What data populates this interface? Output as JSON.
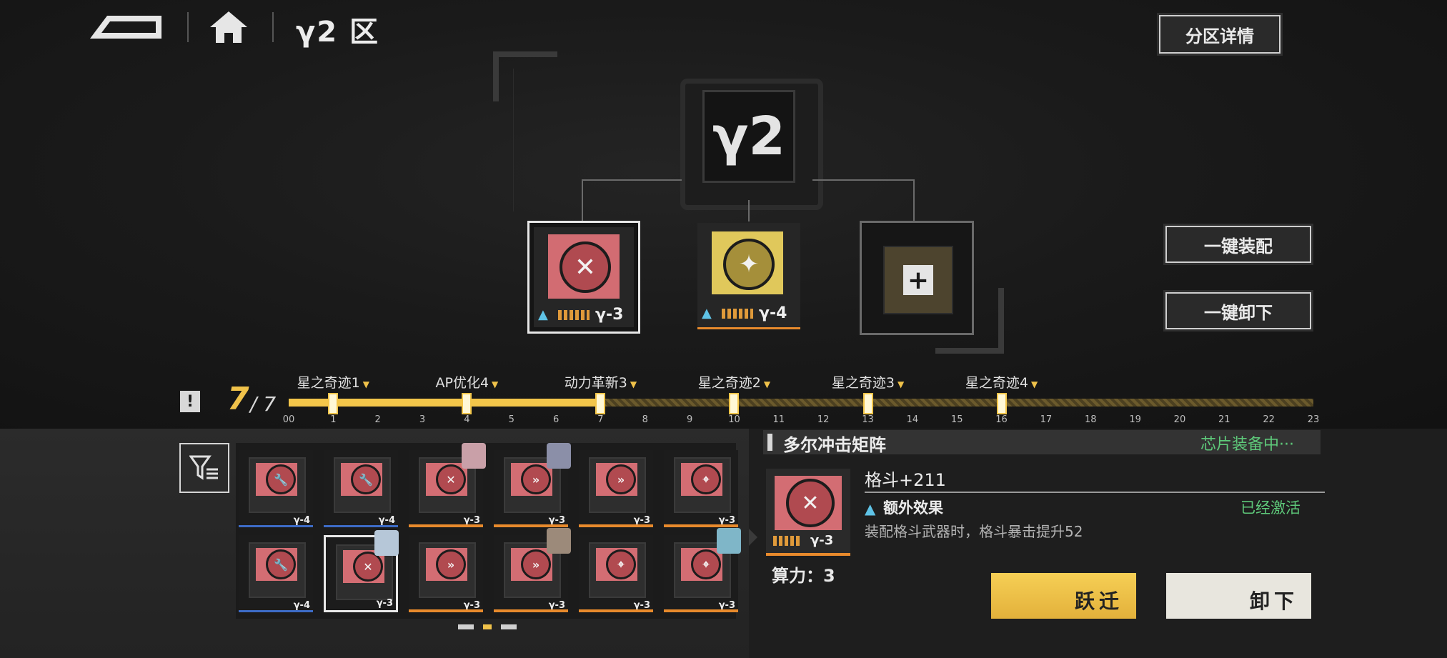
{
  "header": {
    "zone_title": "γ2 区",
    "zone_detail_label": "分区详情"
  },
  "core": {
    "glyph": "γ2"
  },
  "slots": [
    {
      "tier": "γ-3",
      "emblem": "✕"
    },
    {
      "tier": "γ-4",
      "emblem": "✦"
    },
    {
      "add_label": "+"
    }
  ],
  "actions": {
    "equip_all": "一键装配",
    "unequip_all": "一键卸下"
  },
  "progress": {
    "current": "7",
    "max": "/ 7",
    "alert": "!",
    "fraction": 0.304,
    "ticks": [
      "00",
      "1",
      "2",
      "3",
      "4",
      "5",
      "6",
      "7",
      "8",
      "9",
      "10",
      "11",
      "12",
      "13",
      "14",
      "15",
      "16",
      "17",
      "18",
      "19",
      "20",
      "21",
      "22",
      "23"
    ],
    "milestones": [
      {
        "label": "星之奇迹1",
        "at": 1
      },
      {
        "label": "AP优化4",
        "at": 4
      },
      {
        "label": "动力革新3",
        "at": 7
      },
      {
        "label": "星之奇迹2",
        "at": 10
      },
      {
        "label": "星之奇迹3",
        "at": 13
      },
      {
        "label": "星之奇迹4",
        "at": 16
      }
    ]
  },
  "inventory": {
    "cards": [
      {
        "tier": "γ-4",
        "icon": "wrench-icon",
        "glyph": "🔧",
        "bar": "blue"
      },
      {
        "tier": "γ-4",
        "icon": "wrench-icon",
        "glyph": "🔧",
        "bar": "blue"
      },
      {
        "tier": "γ-3",
        "icon": "blade-icon",
        "glyph": "✕",
        "bar": "orange",
        "avatar": true
      },
      {
        "tier": "γ-3",
        "icon": "dash-icon",
        "glyph": "»",
        "bar": "orange",
        "avatar": true
      },
      {
        "tier": "γ-3",
        "icon": "dash-icon",
        "glyph": "»",
        "bar": "orange"
      },
      {
        "tier": "γ-3",
        "icon": "target-icon",
        "glyph": "⌖",
        "bar": "orange"
      },
      {
        "tier": "γ-4",
        "icon": "wrench-icon",
        "glyph": "🔧",
        "bar": "blue"
      },
      {
        "tier": "γ-3",
        "icon": "blade-icon",
        "glyph": "✕",
        "bar": "none",
        "selected": true,
        "avatar": true
      },
      {
        "tier": "γ-3",
        "icon": "dash-icon",
        "glyph": "»",
        "bar": "orange"
      },
      {
        "tier": "γ-3",
        "icon": "dash-icon",
        "glyph": "»",
        "bar": "orange",
        "avatar": true
      },
      {
        "tier": "γ-3",
        "icon": "target-icon",
        "glyph": "⌖",
        "bar": "orange"
      },
      {
        "tier": "γ-3",
        "icon": "target-icon",
        "glyph": "⌖",
        "bar": "orange",
        "avatar": true
      }
    ],
    "page_dots": 3,
    "active_page": 2
  },
  "detail": {
    "title": "多尔冲击矩阵",
    "status": "芯片装备中···",
    "chip_tier": "γ-3",
    "stat": "格斗+211",
    "extra_label": "额外效果",
    "extra_status": "已经激活",
    "extra_desc": "装配格斗武器时，格斗暴击提升52",
    "power": "算力：3",
    "transfer_label": "跃迁",
    "unload_label": "卸下"
  },
  "colors": {
    "accent": "#f3c64a",
    "active_green": "#5ec97a",
    "chip_red": "#d26c72",
    "chip_gold": "#e0c85b"
  }
}
